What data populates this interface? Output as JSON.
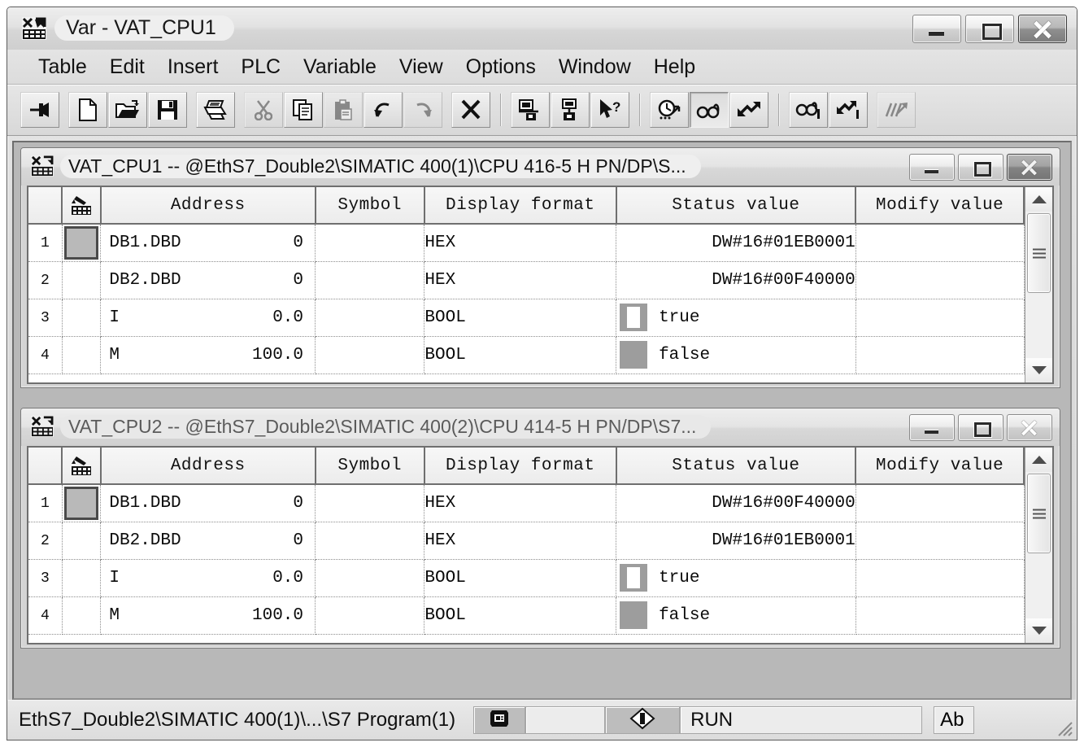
{
  "window": {
    "title": "Var - VAT_CPU1",
    "icon": "vat-table-icon",
    "buttons": {
      "minimize": "Minimize",
      "maximize": "Maximize",
      "close": "Close"
    }
  },
  "menubar": {
    "items": [
      {
        "label": "Table"
      },
      {
        "label": "Edit"
      },
      {
        "label": "Insert"
      },
      {
        "label": "PLC"
      },
      {
        "label": "Variable"
      },
      {
        "label": "View"
      },
      {
        "label": "Options"
      },
      {
        "label": "Window"
      },
      {
        "label": "Help"
      }
    ]
  },
  "toolbar": {
    "buttons": [
      {
        "name": "pin-window-icon",
        "state": "enabled"
      },
      {
        "name": "new-document-icon",
        "state": "enabled"
      },
      {
        "name": "open-folder-icon",
        "state": "enabled"
      },
      {
        "name": "save-floppy-icon",
        "state": "enabled"
      },
      {
        "name": "print-icon",
        "state": "enabled"
      },
      {
        "name": "cut-scissors-icon",
        "state": "disabled"
      },
      {
        "name": "copy-icon",
        "state": "enabled"
      },
      {
        "name": "paste-clipboard-icon",
        "state": "disabled"
      },
      {
        "name": "undo-arrow-icon",
        "state": "enabled"
      },
      {
        "name": "redo-arrow-icon",
        "state": "disabled"
      },
      {
        "name": "delete-cross-icon",
        "state": "enabled"
      },
      {
        "name": "connect-to-plc-icon",
        "state": "enabled"
      },
      {
        "name": "connect-to-cpu-icon",
        "state": "enabled"
      },
      {
        "name": "help-pointer-icon",
        "state": "enabled"
      },
      {
        "name": "trigger-settings-icon",
        "state": "enabled"
      },
      {
        "name": "monitor-variable-icon",
        "state": "pressed"
      },
      {
        "name": "modify-variable-icon",
        "state": "enabled"
      },
      {
        "name": "monitor-once-icon",
        "state": "enabled"
      },
      {
        "name": "modify-once-icon",
        "state": "enabled"
      },
      {
        "name": "force-variable-icon",
        "state": "disabled"
      }
    ]
  },
  "table_columns": [
    "Address",
    "Symbol",
    "Display format",
    "Status value",
    "Modify value"
  ],
  "windows": [
    {
      "id": "vat-cpu1",
      "active": true,
      "title": "VAT_CPU1 -- @EthS7_Double2\\SIMATIC 400(1)\\CPU 416-5 H PN/DP\\S...",
      "rows": [
        {
          "num": "1",
          "addr_name": "DB1.DBD",
          "addr_offset": "0",
          "symbol": "",
          "format": "HEX",
          "status": "DW#16#01EB0001",
          "bool": null,
          "modify": "",
          "selected": true
        },
        {
          "num": "2",
          "addr_name": "DB2.DBD",
          "addr_offset": "0",
          "symbol": "",
          "format": "HEX",
          "status": "DW#16#00F40000",
          "bool": null,
          "modify": "",
          "selected": false
        },
        {
          "num": "3",
          "addr_name": "I",
          "addr_offset": "0.0",
          "symbol": "",
          "format": "BOOL",
          "status": "true",
          "bool": "on",
          "modify": "",
          "selected": false
        },
        {
          "num": "4",
          "addr_name": "M",
          "addr_offset": "100.0",
          "symbol": "",
          "format": "BOOL",
          "status": "false",
          "bool": "off",
          "modify": "",
          "selected": false
        }
      ]
    },
    {
      "id": "vat-cpu2",
      "active": false,
      "title": "VAT_CPU2 -- @EthS7_Double2\\SIMATIC 400(2)\\CPU 414-5 H PN/DP\\S7...",
      "rows": [
        {
          "num": "1",
          "addr_name": "DB1.DBD",
          "addr_offset": "0",
          "symbol": "",
          "format": "HEX",
          "status": "DW#16#00F40000",
          "bool": null,
          "modify": "",
          "selected": true
        },
        {
          "num": "2",
          "addr_name": "DB2.DBD",
          "addr_offset": "0",
          "symbol": "",
          "format": "HEX",
          "status": "DW#16#01EB0001",
          "bool": null,
          "modify": "",
          "selected": false
        },
        {
          "num": "3",
          "addr_name": "I",
          "addr_offset": "0.0",
          "symbol": "",
          "format": "BOOL",
          "status": "true",
          "bool": "on",
          "modify": "",
          "selected": false
        },
        {
          "num": "4",
          "addr_name": "M",
          "addr_offset": "100.0",
          "symbol": "",
          "format": "BOOL",
          "status": "false",
          "bool": "off",
          "modify": "",
          "selected": false
        }
      ]
    }
  ],
  "statusbar": {
    "path": "EthS7_Double2\\SIMATIC 400(1)\\...\\S7 Program(1)",
    "connection_icon": "plc-connection-icon",
    "blank_panel": "",
    "mode_icon": "operating-mode-icon",
    "operating_mode": "RUN",
    "absolute_mode": "Ab"
  },
  "colors": {
    "status_cell_bg": "#c8c8c8",
    "mark_column_bg": "#b9b9b9",
    "bool_true": "#ffffff",
    "bool_false": "#9d9d9d",
    "window_chrome": "#d8d8d8"
  }
}
